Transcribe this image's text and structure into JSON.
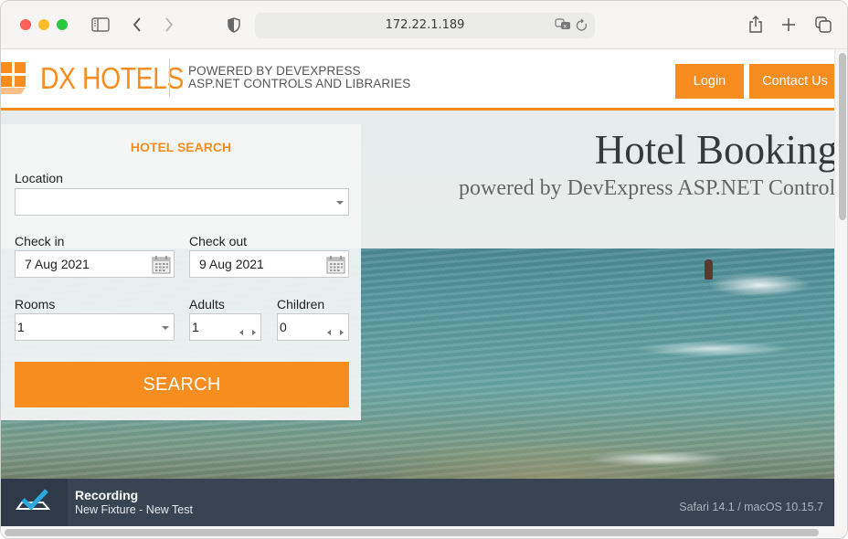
{
  "browser": {
    "address": "172.22.1.189",
    "icons": [
      "sidebar-icon",
      "back-icon",
      "forward-icon",
      "privacy-shield-icon",
      "translate-icon",
      "reload-icon",
      "share-icon",
      "new-tab-icon",
      "tab-overview-icon"
    ]
  },
  "header": {
    "logo_text": "DX HOTELS",
    "powered_line1": "POWERED BY DEVEXPRESS",
    "powered_line2": "ASP.NET CONTROLS AND LIBRARIES",
    "login_label": "Login",
    "contact_label": "Contact Us"
  },
  "hero": {
    "title": "Hotel Booking",
    "subtitle": "powered by DevExpress ASP.NET Controls"
  },
  "search": {
    "title": "HOTEL SEARCH",
    "location_label": "Location",
    "location_value": "",
    "checkin_label": "Check in",
    "checkin_value": "7 Aug 2021",
    "checkout_label": "Check out",
    "checkout_value": "9 Aug 2021",
    "rooms_label": "Rooms",
    "rooms_value": "1",
    "adults_label": "Adults",
    "adults_value": "1",
    "children_label": "Children",
    "children_value": "0",
    "search_label": "SEARCH"
  },
  "recording": {
    "title": "Recording",
    "subtitle": "New Fixture - New Test",
    "environment": "Safari 14.1 / macOS 10.15.7"
  },
  "colors": {
    "accent": "#f78d1f",
    "recording_bar": "#384452"
  }
}
